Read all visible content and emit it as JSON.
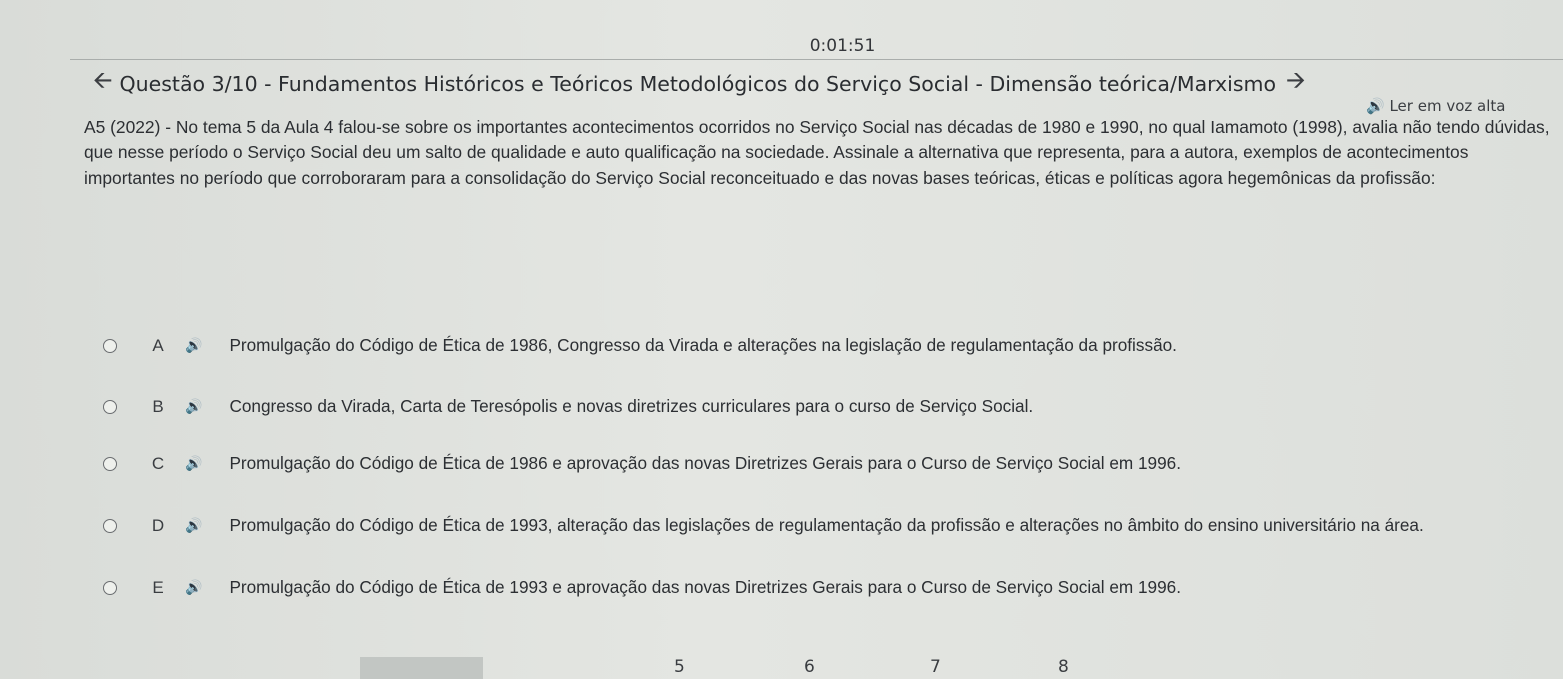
{
  "timer": "0:01:51",
  "question": {
    "title": "Questão 3/10 - Fundamentos Históricos e Teóricos Metodológicos do Serviço Social - Dimensão teórica/Marxismo",
    "prev_icon": "arrow-left-icon",
    "next_icon": "arrow-right-icon",
    "read_aloud_label": "Ler em voz alta",
    "prompt": "A5 (2022) - No tema 5 da Aula 4 falou-se sobre os importantes acontecimentos ocorridos no Serviço Social nas décadas de 1980 e 1990, no qual Iamamoto (1998), avalia não tendo dúvidas, que nesse período o Serviço Social deu um salto de qualidade e auto qualificação na sociedade. Assinale a alternativa que representa, para a autora, exemplos de acontecimentos importantes no período que corroboraram para a consolidação do Serviço Social reconceituado e das novas bases teóricas, éticas e políticas agora hegemônicas da profissão:"
  },
  "options": [
    {
      "letter": "A",
      "text": "Promulgação do Código de Ética de 1986, Congresso da Virada e alterações na legislação de regulamentação da profissão."
    },
    {
      "letter": "B",
      "text": "Congresso da Virada, Carta de Teresópolis e novas diretrizes curriculares para o curso de Serviço Social."
    },
    {
      "letter": "C",
      "text": "Promulgação do Código de Ética de 1986 e aprovação das novas Diretrizes Gerais para o Curso de Serviço Social em 1996."
    },
    {
      "letter": "D",
      "text": "Promulgação do Código de Ética de 1993, alteração das legislações de regulamentação da profissão e alterações no âmbito do ensino universitário na área."
    },
    {
      "letter": "E",
      "text": "Promulgação do Código de Ética de 1993 e aprovação das novas Diretrizes Gerais para o Curso de Serviço Social em 1996."
    }
  ],
  "speaker_icon": "speaker-icon",
  "pagination": {
    "pages": [
      "5",
      "6",
      "7",
      "8"
    ]
  }
}
